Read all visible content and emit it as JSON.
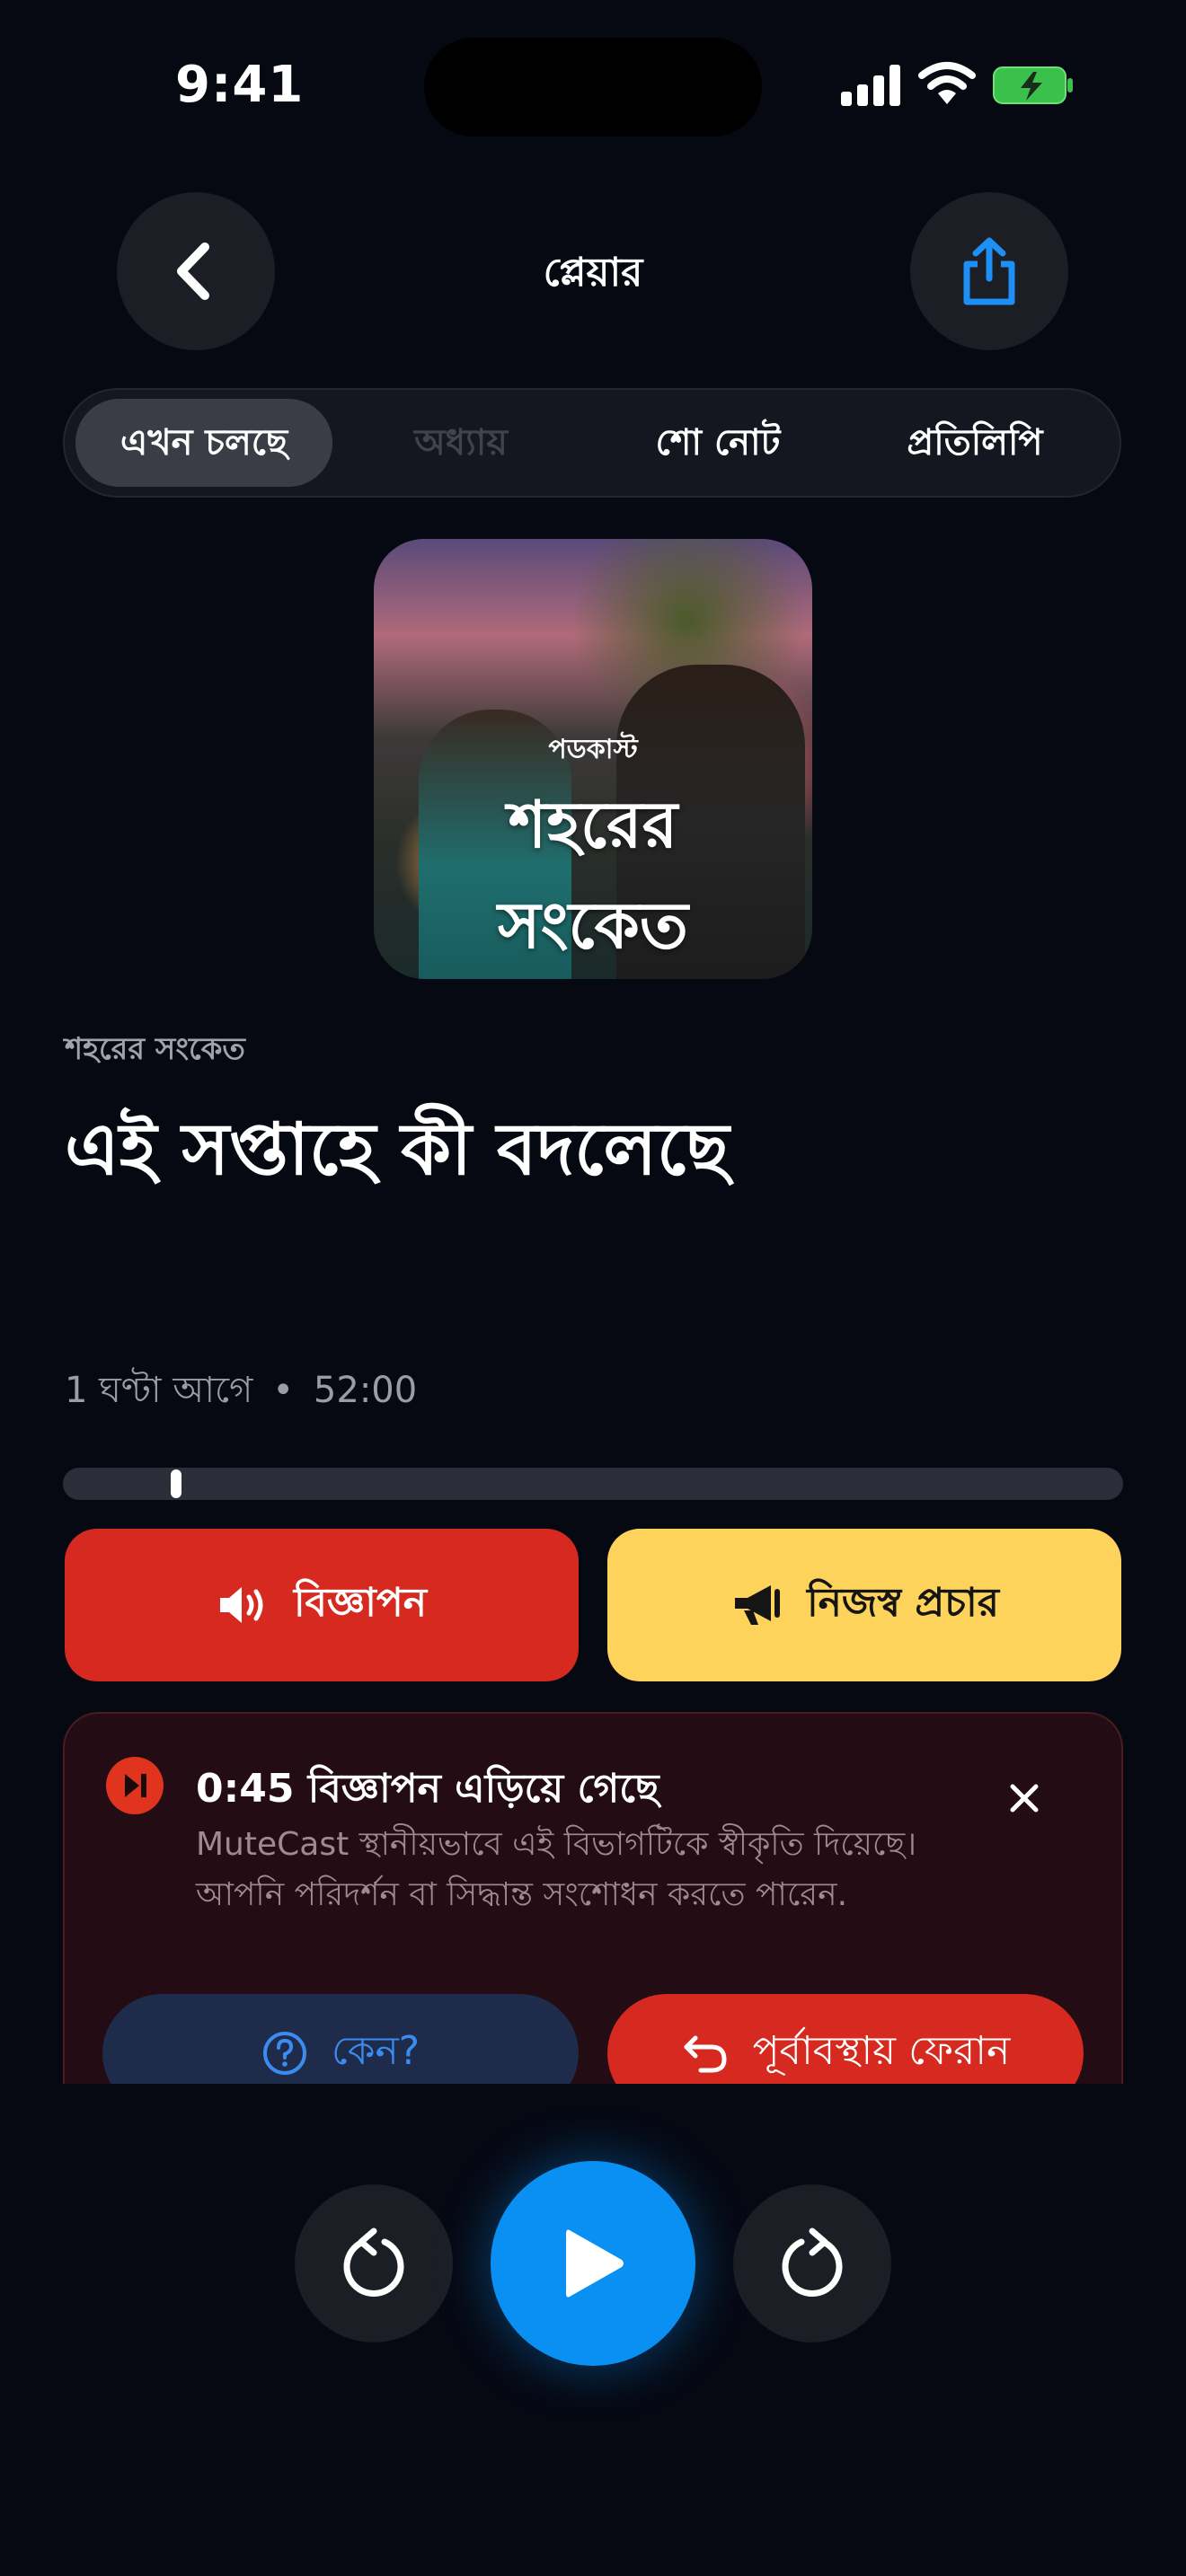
{
  "status_bar": {
    "time": "9:41"
  },
  "header": {
    "title": "প্লেয়ার"
  },
  "tabs": [
    {
      "label": "এখন চলছে",
      "active": true
    },
    {
      "label": "অধ্যায়",
      "disabled": true
    },
    {
      "label": "শো নোট"
    },
    {
      "label": "প্রতিলিপি"
    }
  ],
  "cover": {
    "kicker": "পডকাস্ট",
    "title_line1": "শহরের",
    "title_line2": "সংকেত"
  },
  "episode": {
    "show_name": "শহরের সংকেত",
    "title": "এই সপ্তাহে কী বদলেছে",
    "published": "1 ঘণ্টা আগে",
    "separator": "•",
    "duration": "52:00",
    "progress_fraction": 0.085
  },
  "actions": {
    "ad_label": "বিজ্ঞাপন",
    "promo_label": "নিজস্ব প্রচার"
  },
  "notice": {
    "title": "0:45 বিজ্ঞাপন এড়িয়ে গেছে",
    "body": "MuteCast স্থানীয়ভাবে এই বিভাগটিকে স্বীকৃতি দিয়েছে। আপনি পরিদর্শন বা সিদ্ধান্ত সংশোধন করতে পারেন.",
    "why_label": "কেন?",
    "restore_label": "পূর্বাবস্থায় ফেরান"
  },
  "colors": {
    "accent": "#0a8ff2",
    "ad_red": "#d6291f",
    "promo_yellow": "#fdd35c",
    "background": "#060812"
  }
}
